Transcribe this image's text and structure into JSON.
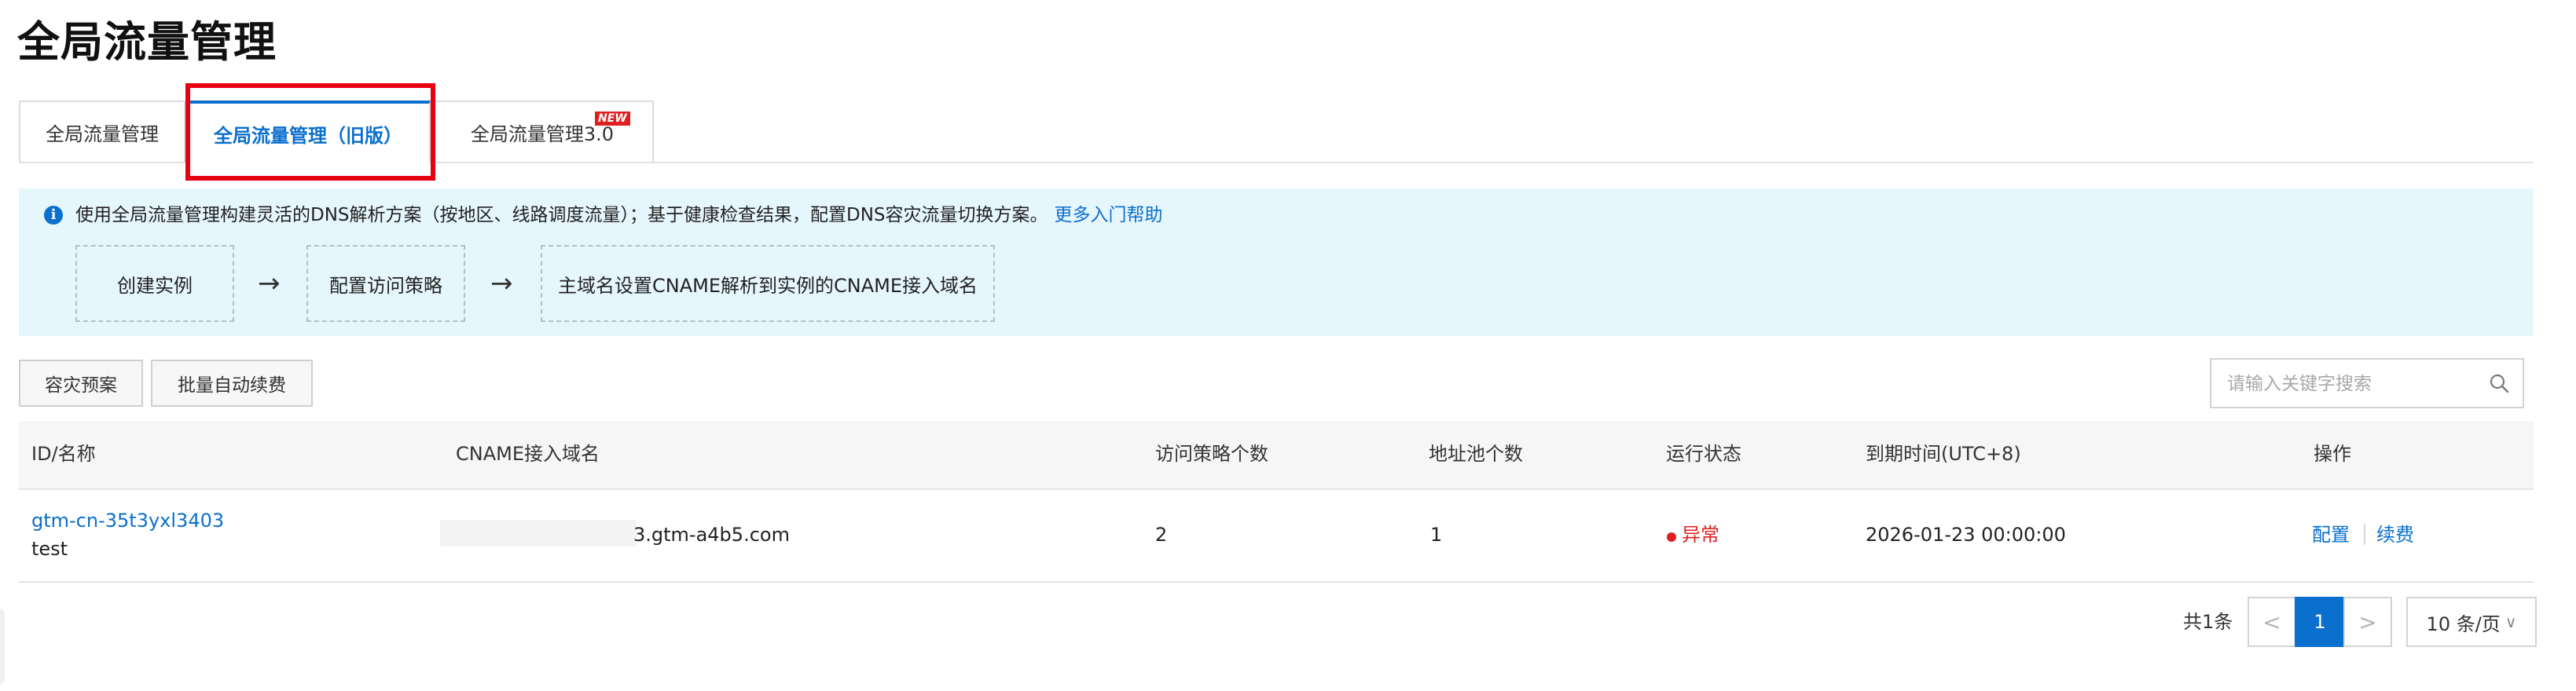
{
  "page": {
    "title": "全局流量管理"
  },
  "tabs": [
    {
      "label": "全局流量管理"
    },
    {
      "label": "全局流量管理（旧版）"
    },
    {
      "label": "全局流量管理3.0",
      "badge": "NEW"
    }
  ],
  "notice": {
    "text": "使用全局流量管理构建灵活的DNS解析方案（按地区、线路调度流量）；基于健康检查结果，配置DNS容灾流量切换方案。",
    "link": "更多入门帮助",
    "steps": [
      "创建实例",
      "配置访问策略",
      "主域名设置CNAME解析到实例的CNAME接入域名"
    ]
  },
  "toolbar": {
    "buttons": [
      "容灾预案",
      "批量自动续费"
    ],
    "search_placeholder": "请输入关键字搜索"
  },
  "table": {
    "columns": [
      "ID/名称",
      "CNAME接入域名",
      "访问策略个数",
      "地址池个数",
      "运行状态",
      "到期时间(UTC+8)",
      "操作"
    ],
    "rows": [
      {
        "id": "gtm-cn-35t3yxl3403",
        "name": "test",
        "cname": "3.gtm-a4b5.com",
        "policies": "2",
        "pools": "1",
        "status": "异常",
        "expire": "2026-01-23 00:00:00",
        "actions": [
          "配置",
          "续费"
        ]
      }
    ]
  },
  "pagination": {
    "total": "共1条",
    "prev": "<",
    "current": "1",
    "next": ">",
    "page_size": "10 条/页"
  },
  "colors": {
    "primary": "#0b6fce",
    "error": "#e02020",
    "highlight": "#e60012",
    "notice_bg": "#e6f6fd"
  }
}
